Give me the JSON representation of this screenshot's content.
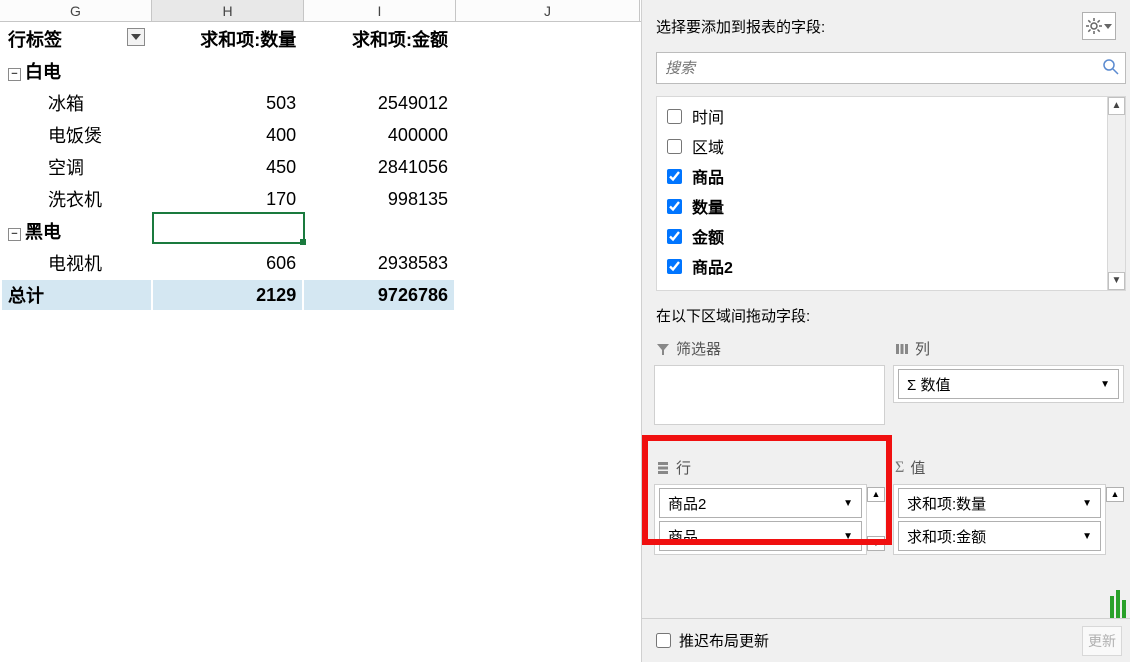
{
  "columns": {
    "G": "G",
    "H": "H",
    "I": "I",
    "J": "J"
  },
  "pivot": {
    "headers": {
      "rowlabel": "行标签",
      "qty": "求和项:数量",
      "amt": "求和项:金额"
    },
    "groups": [
      {
        "label": "白电",
        "items": [
          {
            "label": "冰箱",
            "qty": 503,
            "amt": 2549012
          },
          {
            "label": "电饭煲",
            "qty": 400,
            "amt": 400000
          },
          {
            "label": "空调",
            "qty": 450,
            "amt": 2841056
          },
          {
            "label": "洗衣机",
            "qty": 170,
            "amt": 998135
          }
        ]
      },
      {
        "label": "黑电",
        "items": [
          {
            "label": "电视机",
            "qty": 606,
            "amt": 2938583
          }
        ]
      }
    ],
    "total": {
      "label": "总计",
      "qty": 2129,
      "amt": 9726786
    }
  },
  "pane": {
    "choose_label": "选择要添加到报表的字段:",
    "search_placeholder": "搜索",
    "drag_hint": "在以下区域间拖动字段:"
  },
  "fields": [
    {
      "label": "时间",
      "checked": false
    },
    {
      "label": "区域",
      "checked": false
    },
    {
      "label": "商品",
      "checked": true
    },
    {
      "label": "数量",
      "checked": true
    },
    {
      "label": "金额",
      "checked": true
    },
    {
      "label": "商品2",
      "checked": true
    }
  ],
  "areas": {
    "filters_label": "筛选器",
    "columns_label": "列",
    "columns_items": [
      "Σ 数值"
    ],
    "rows_label": "行",
    "rows_items": [
      "商品2",
      "商品"
    ],
    "values_label": "值",
    "values_items": [
      "求和项:数量",
      "求和项:金额"
    ]
  },
  "bottom": {
    "defer": "推迟布局更新",
    "update": "更新"
  },
  "chart_data": {
    "type": "table",
    "columns": [
      "行标签",
      "求和项:数量",
      "求和项:金额"
    ],
    "rows": [
      [
        "白电",
        null,
        null
      ],
      [
        "冰箱",
        503,
        2549012
      ],
      [
        "电饭煲",
        400,
        400000
      ],
      [
        "空调",
        450,
        2841056
      ],
      [
        "洗衣机",
        170,
        998135
      ],
      [
        "黑电",
        null,
        null
      ],
      [
        "电视机",
        606,
        2938583
      ],
      [
        "总计",
        2129,
        9726786
      ]
    ]
  }
}
